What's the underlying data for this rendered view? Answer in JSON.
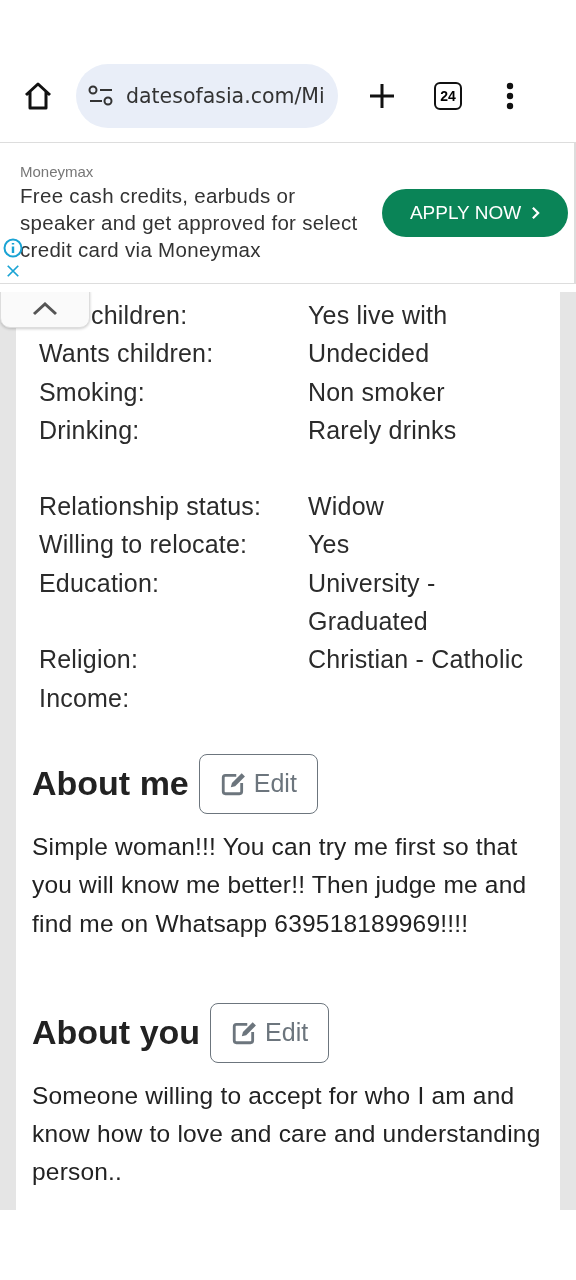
{
  "browser": {
    "url": "datesofasia.com/Mi",
    "tab_count": "24"
  },
  "ad": {
    "advertiser": "Moneymax",
    "text": "Free cash credits, earbuds or speaker and get approved for select credit card via Moneymax",
    "button": "APPLY NOW"
  },
  "detail_groups": [
    [
      {
        "label": "children:",
        "value": "Yes live with"
      },
      {
        "label": "Wants children:",
        "value": "Undecided"
      },
      {
        "label": "Smoking:",
        "value": "Non smoker"
      },
      {
        "label": "Drinking:",
        "value": "Rarely drinks"
      }
    ],
    [
      {
        "label": "Relationship status:",
        "value": "Widow"
      },
      {
        "label": "Willing to relocate:",
        "value": "Yes"
      },
      {
        "label": "Education:",
        "value": "University - Graduated"
      },
      {
        "label": "Religion:",
        "value": "Christian - Catholic"
      },
      {
        "label": "Income:"
      }
    ]
  ],
  "sections": [
    {
      "title": "About me",
      "edit": "Edit",
      "text": "Simple woman!!! You can try me first so that you will know me better!! Then judge me and find me on Whatsapp 639518189969!!!!"
    },
    {
      "title": "About you",
      "edit": "Edit",
      "text": "Someone willing to accept for who I am and know how to love and care and understanding person.."
    }
  ]
}
